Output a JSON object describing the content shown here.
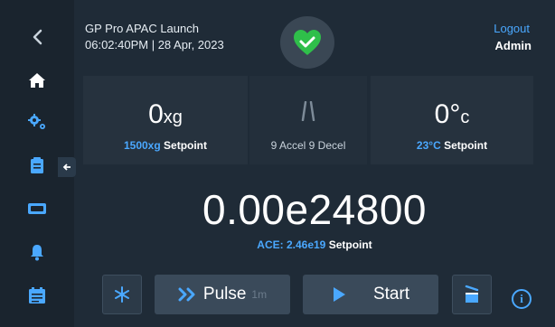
{
  "colors": {
    "accent": "#4aa8ff",
    "status_green": "#2fbf4a",
    "background": "#1f2b37",
    "sidebar": "#1a242e"
  },
  "header": {
    "title": "GP Pro APAC Launch",
    "datetime": "06:02:40PM | 28 Apr, 2023",
    "status_icon": "heart-check-icon",
    "logout_label": "Logout",
    "user": "Admin"
  },
  "sidebar": {
    "items": [
      {
        "icon": "back-chevron-icon"
      },
      {
        "icon": "home-icon"
      },
      {
        "icon": "settings-gears-icon"
      },
      {
        "icon": "clipboard-icon"
      },
      {
        "icon": "rotor-icon"
      },
      {
        "icon": "bell-icon"
      },
      {
        "icon": "programs-icon"
      }
    ],
    "collapse_icon": "arrow-left-icon"
  },
  "speed": {
    "value": "0",
    "unit": "xg",
    "setpoint_value": "1500xg",
    "setpoint_label": "Setpoint"
  },
  "accel": {
    "icon": "road-icon",
    "accel_text": "9 Accel",
    "decel_text": "9 Decel"
  },
  "temperature": {
    "value": "0",
    "unit_degree": "°",
    "unit": "c",
    "setpoint_value": "23°C",
    "setpoint_label": "Setpoint"
  },
  "ace": {
    "value": "0.00e24800",
    "setpoint_value": "ACE: 2.46e19",
    "setpoint_label": "Setpoint"
  },
  "buttons": {
    "snow_icon": "snowflake-icon",
    "pulse_label": "Pulse",
    "pulse_time": "1m",
    "start_label": "Start",
    "lid_icon": "lid-open-icon",
    "info_label": "i"
  }
}
